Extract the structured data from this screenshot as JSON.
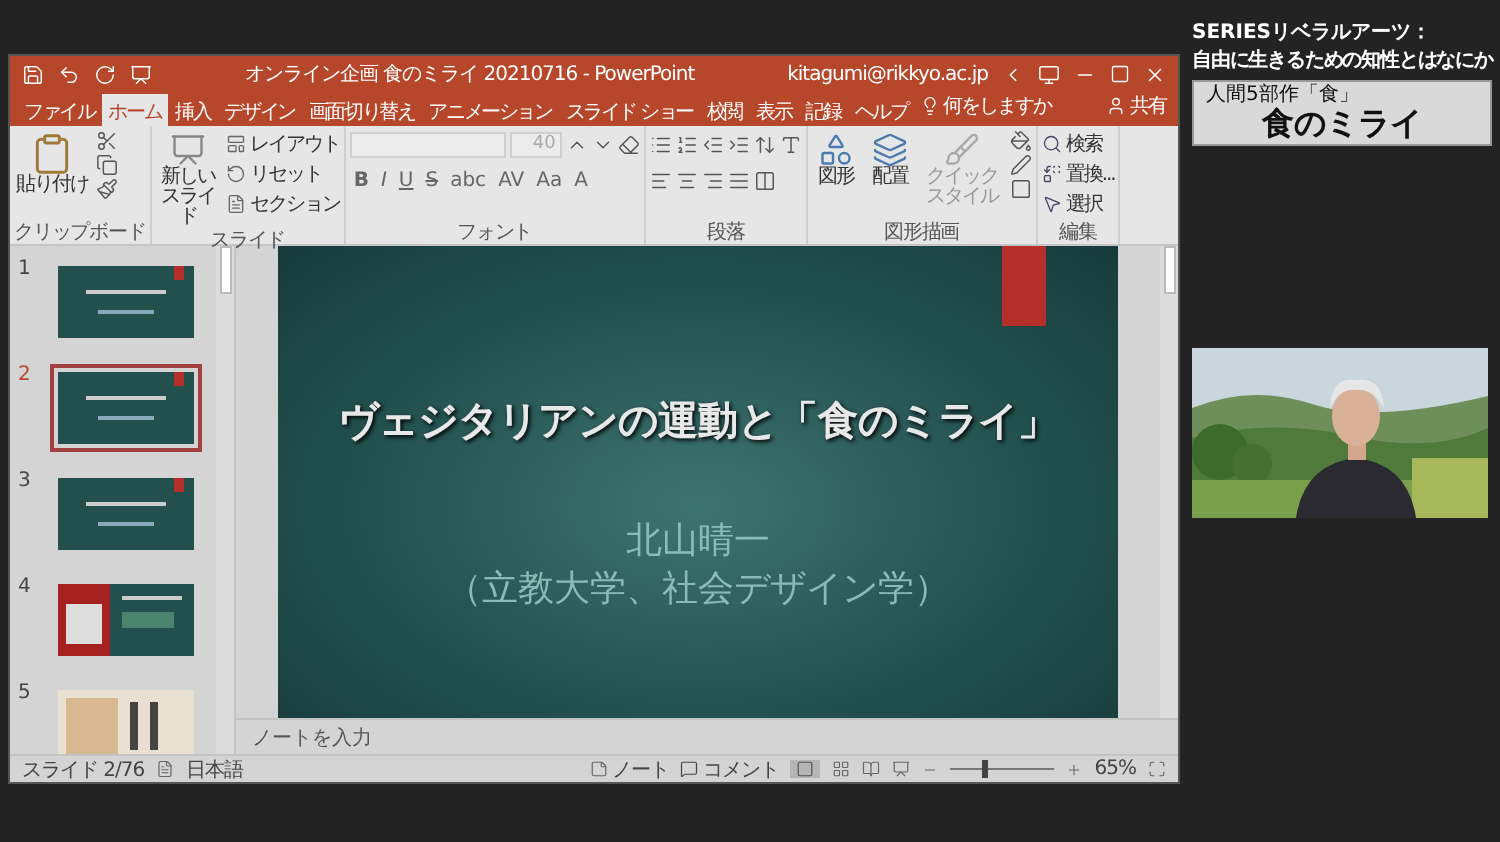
{
  "overlay": {
    "series": "SERIESリベラルアーツ：",
    "subtitle": "自由に生きるための知性とはなにか",
    "caption_small": "人間5部作「食」",
    "caption": "食のミライ"
  },
  "window": {
    "title": "オンライン企画 食のミライ 20210716 - PowerPoint",
    "account": "kitagumi@rikkyo.ac.jp"
  },
  "tabs": [
    {
      "label": "ファイル",
      "selected": false
    },
    {
      "label": "ホーム",
      "selected": true
    },
    {
      "label": "挿入",
      "selected": false
    },
    {
      "label": "デザイン",
      "selected": false
    },
    {
      "label": "画面切り替え",
      "selected": false
    },
    {
      "label": "アニメーション",
      "selected": false
    },
    {
      "label": "スライド ショー",
      "selected": false
    },
    {
      "label": "校閲",
      "selected": false
    },
    {
      "label": "表示",
      "selected": false
    },
    {
      "label": "記録",
      "selected": false
    },
    {
      "label": "ヘルプ",
      "selected": false
    }
  ],
  "tell_me": "何をしますか",
  "share": "共有",
  "ribbon": [
    {
      "kind": "clipboard",
      "label": "クリップボード",
      "main": "貼り付け"
    },
    {
      "kind": "slides",
      "label": "スライド",
      "main": "新しいスライド",
      "items": [
        "レイアウト",
        "リセット",
        "セクション"
      ]
    },
    {
      "kind": "font",
      "label": "フォント",
      "size": "40",
      "buttons": [
        "B",
        "I",
        "U",
        "S",
        "abc",
        "AV",
        "Aa",
        "A"
      ]
    },
    {
      "kind": "paragraph",
      "label": "段落"
    },
    {
      "kind": "drawing",
      "label": "図形描画",
      "items": [
        "図形",
        "配置",
        "クイックスタイル"
      ]
    },
    {
      "kind": "editing",
      "label": "編集",
      "items": [
        "検索",
        "置換...",
        "選択"
      ]
    }
  ],
  "thumbnails": [
    {
      "number": "1",
      "kind": "dark",
      "selected": false
    },
    {
      "number": "2",
      "kind": "dark",
      "selected": true
    },
    {
      "number": "3",
      "kind": "dark",
      "selected": false
    },
    {
      "number": "4",
      "kind": "red",
      "selected": false
    },
    {
      "number": "5",
      "kind": "paper",
      "selected": false
    }
  ],
  "slide": {
    "title": "ヴェジタリアンの運動と「食のミライ」",
    "author": "北山晴一",
    "affiliation": "（立教大学、社会デザイン学）"
  },
  "notes_placeholder": "ノートを入力",
  "status": {
    "slide": "スライド 2/76",
    "language": "日本語",
    "notes": "ノート",
    "comments": "コメント",
    "zoom": "65%",
    "zoom_slider": {
      "level": 0.31
    }
  }
}
